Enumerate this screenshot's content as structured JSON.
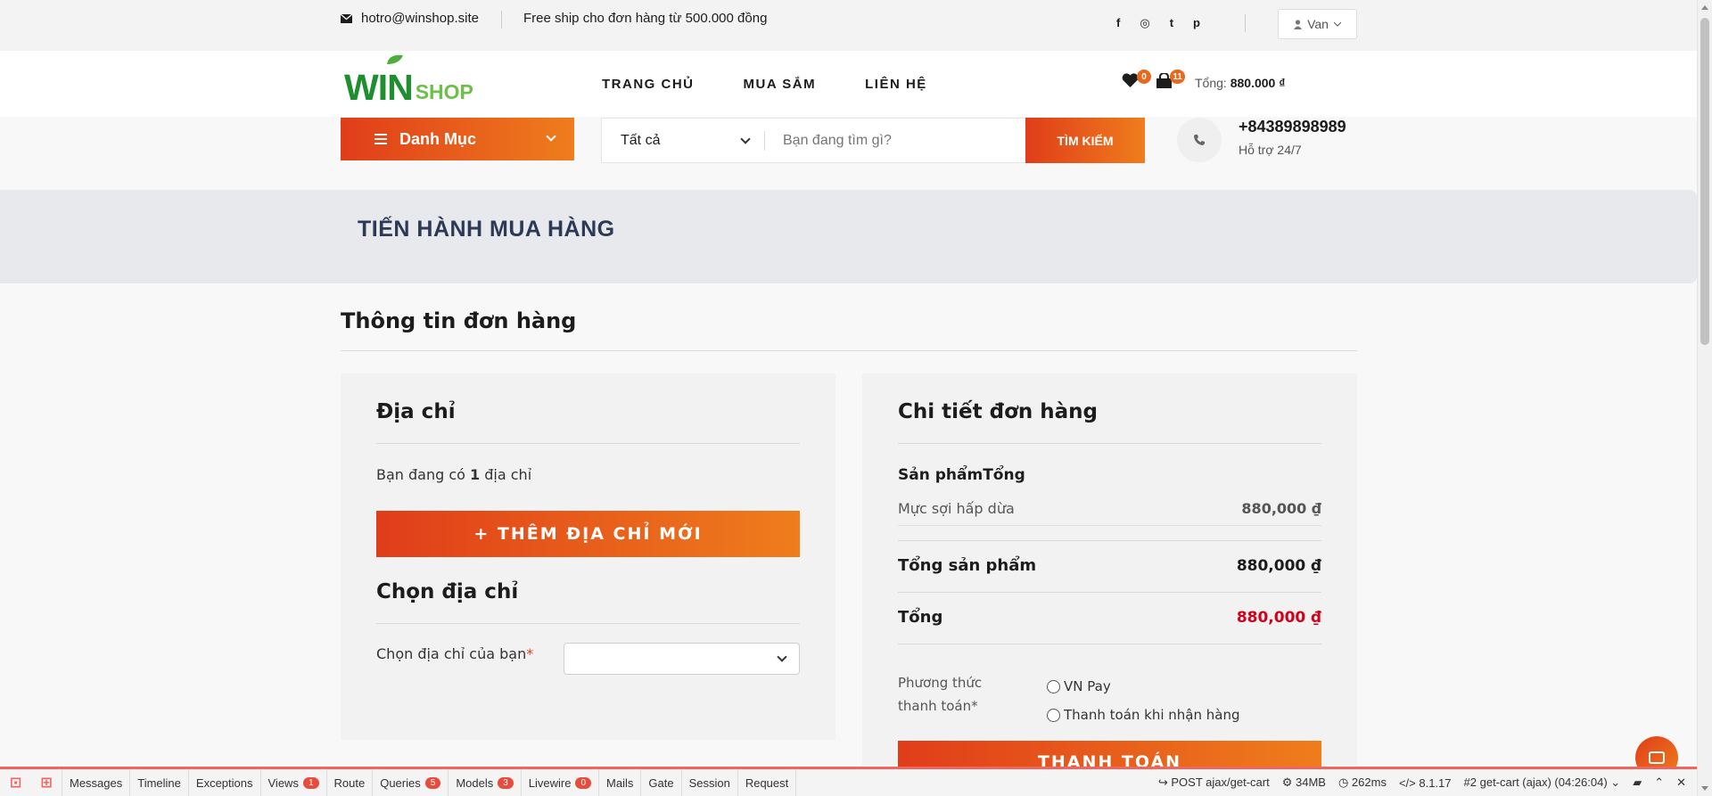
{
  "topbar": {
    "email": "hotro@winshop.site",
    "shipping": "Free ship cho đơn hàng từ 500.000 đồng",
    "socials": [
      "f",
      "◎",
      "t",
      "p"
    ],
    "user": "Van"
  },
  "header": {
    "logo_win": "WIN",
    "logo_shop": "SHOP",
    "nav": [
      "TRANG CHỦ",
      "MUA SẮM",
      "LIÊN HỆ"
    ],
    "wishlist_count": "0",
    "cart_count": "11",
    "total_label": "Tổng:",
    "total_value": "880.000 ₫"
  },
  "toolbar": {
    "category_label": "Danh Mục",
    "search_scope": "Tất cả",
    "search_placeholder": "Bạn đang tìm gì?",
    "search_button": "TÌM KIẾM",
    "phone": "+84389898989",
    "support": "Hỗ trợ 24/7"
  },
  "banner": {
    "title": "TIẾN HÀNH MUA HÀNG"
  },
  "section": {
    "title": "Thông tin đơn hàng"
  },
  "address": {
    "heading": "Địa chỉ",
    "count_prefix": "Bạn đang có ",
    "count": "1",
    "count_suffix": " địa chỉ",
    "add_button": "+ THÊM ĐỊA CHỈ MỚI",
    "choose_heading": "Chọn địa chỉ",
    "choose_label": "Chọn địa chỉ của bạn",
    "required_mark": "*"
  },
  "order": {
    "heading": "Chi tiết đơn hàng",
    "col_product": "Sản phẩm",
    "col_total": "Tổng",
    "items": [
      {
        "name": "Mực sợi hấp dừa",
        "price": "880,000 ₫"
      }
    ],
    "subtotal_label": "Tổng sản phẩm",
    "subtotal_value": "880,000 ₫",
    "total_label": "Tổng",
    "total_value": "880,000 ₫",
    "payment_label_1": "Phương thức",
    "payment_label_2": "thanh toán*",
    "payment_options": [
      "VN Pay",
      "Thanh toán khi nhận hàng"
    ],
    "pay_button": "THANH TOÁN"
  },
  "debugbar": {
    "tabs": [
      {
        "label": "Messages",
        "count": ""
      },
      {
        "label": "Timeline",
        "count": ""
      },
      {
        "label": "Exceptions",
        "count": ""
      },
      {
        "label": "Views",
        "count": "1"
      },
      {
        "label": "Route",
        "count": ""
      },
      {
        "label": "Queries",
        "count": "5"
      },
      {
        "label": "Models",
        "count": "3"
      },
      {
        "label": "Livewire",
        "count": "0"
      },
      {
        "label": "Mails",
        "count": ""
      },
      {
        "label": "Gate",
        "count": ""
      },
      {
        "label": "Session",
        "count": ""
      },
      {
        "label": "Request",
        "count": ""
      }
    ],
    "request": "POST ajax/get-cart",
    "memory": "34MB",
    "time": "262ms",
    "php": "8.1.17",
    "selected_request": "#2 get-cart (ajax) (04:26:04)"
  },
  "colors": {
    "accent_start": "#e03d1a",
    "accent_end": "#ef7d1c",
    "price_red": "#d0021b",
    "brand_green": "#1e8e2e"
  }
}
